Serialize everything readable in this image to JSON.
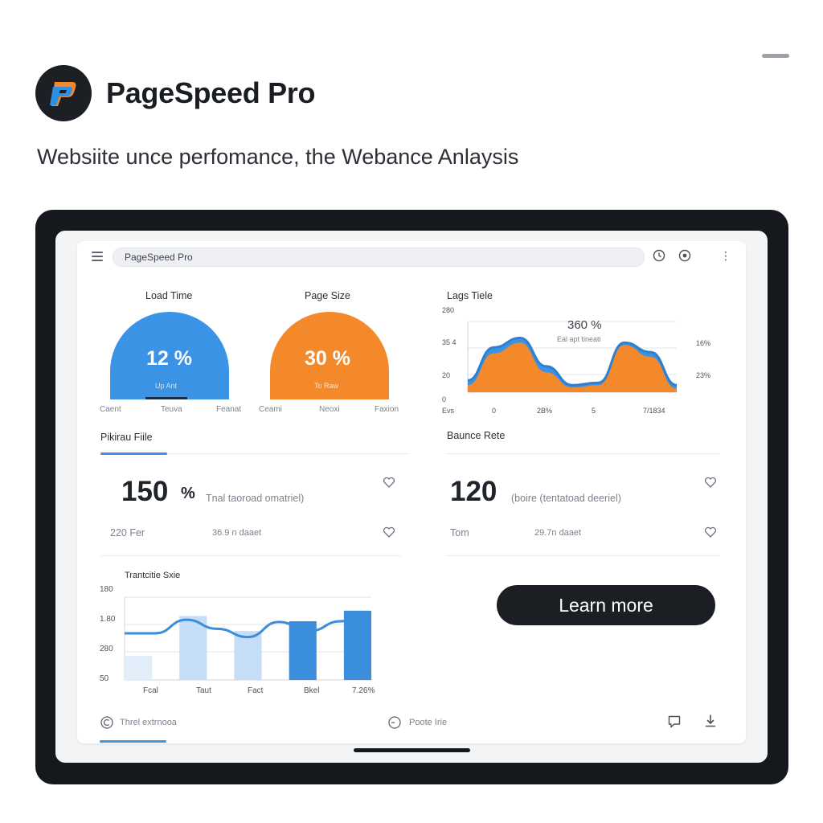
{
  "brand": {
    "name": "PageSpeed Pro",
    "tagline": "Websiite unce perfomance, the Webance Anlaysis"
  },
  "browser": {
    "address_text": "PageSpeed Pro"
  },
  "gauges": [
    {
      "title": "Load Time",
      "value": "12 %",
      "sub": "Up Ant",
      "labels": [
        "Caent",
        "Teuva",
        "Feanat"
      ],
      "color": "#3a93e4"
    },
    {
      "title": "Page Size",
      "value": "30 %",
      "sub": "To Raw",
      "labels": [
        "Ceami",
        "Neoxi",
        "Faxion"
      ],
      "color": "#f4892c"
    }
  ],
  "metrics": [
    {
      "title": "Pikirau Fiile",
      "value": "150",
      "unit": "%",
      "desc": "Tnal taoroad omatriel)",
      "foot_left": "220 Fer",
      "foot_right": "36.9 n daaet"
    },
    {
      "title": "Baunce Rete",
      "value": "120",
      "unit": "",
      "desc": "(boire (tentatoad deeriel)",
      "foot_left": "Tom",
      "foot_right": "29.7n daaet"
    }
  ],
  "cta": {
    "label": "Learn more"
  },
  "bottom_bar": {
    "left_label": "Threl extrnooa",
    "center_label": "Poote Irie"
  },
  "colors": {
    "accent_blue": "#3a93e4",
    "accent_orange": "#f4892c",
    "dark": "#1b1e23"
  },
  "icons": {
    "menu": "hamburger-icon",
    "clock": "clock-icon",
    "settings": "gear-icon",
    "more": "vertical-dots-icon",
    "favorite": "heart-icon",
    "comment": "speech-bubble-icon",
    "download": "download-icon",
    "refresh": "refresh-icon",
    "timer": "timer-icon"
  },
  "chart_data": [
    {
      "type": "area",
      "title": "Lags Tiele",
      "annotation_value": "360 %",
      "annotation_sub": "Eal apt tineati",
      "y_tick_labels_left": [
        "280",
        "35 4",
        "20",
        "0"
      ],
      "y_tick_labels_right": [
        "16%",
        "23%"
      ],
      "x_tick_labels": [
        "Evs",
        "0",
        "2B%",
        "5",
        "7/1834"
      ],
      "series": [
        {
          "x": [
            0,
            1,
            2,
            3,
            4,
            5,
            6,
            7,
            8
          ],
          "values": [
            10,
            38,
            46,
            22,
            6,
            8,
            42,
            34,
            6
          ]
        },
        {
          "x": [
            0,
            1,
            2,
            3,
            4,
            5,
            6,
            7,
            8
          ],
          "values": [
            6,
            33,
            42,
            17,
            4,
            6,
            40,
            30,
            3
          ]
        }
      ],
      "ylim": [
        0,
        60
      ],
      "grid": true,
      "colors": [
        "#3a93e4",
        "#f4892c"
      ]
    },
    {
      "type": "bar",
      "title": "Trantcitie Sxie",
      "y_tick_labels": [
        "180",
        "1.80",
        "280",
        "50"
      ],
      "x_tick_labels": [
        "Fcal",
        "Taut",
        "Fact",
        "Bkel",
        "7.26%"
      ],
      "categories": [
        "1",
        "2",
        "3",
        "4",
        "5",
        "6",
        "7",
        "8",
        "9"
      ],
      "bars": [
        {
          "value": 32,
          "color": "#e3eefb"
        },
        {
          "value": 0,
          "color": "#ffffff"
        },
        {
          "value": 85,
          "color": "#c5ddf6"
        },
        {
          "value": 0,
          "color": "#ffffff"
        },
        {
          "value": 65,
          "color": "#c5ddf6"
        },
        {
          "value": 0,
          "color": "#ffffff"
        },
        {
          "value": 78,
          "color": "#3a8edb"
        },
        {
          "value": 0,
          "color": "#ffffff"
        },
        {
          "value": 92,
          "color": "#3a8edb"
        }
      ],
      "line": [
        62,
        62,
        80,
        68,
        57,
        77,
        65,
        78,
        88
      ],
      "ylim": [
        0,
        110
      ],
      "grid": true
    }
  ]
}
